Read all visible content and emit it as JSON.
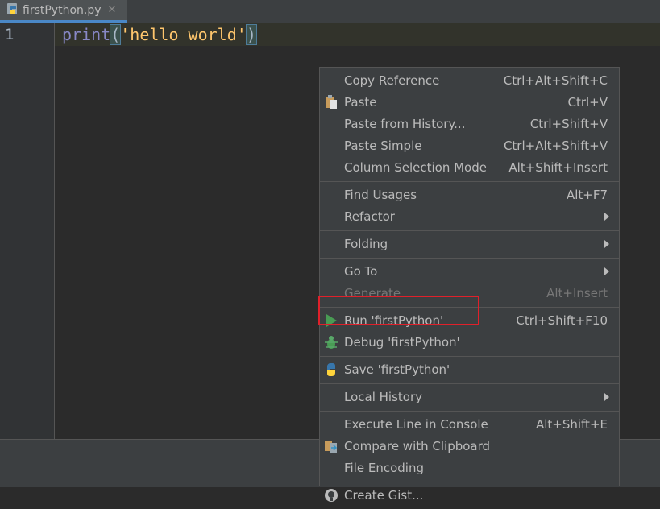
{
  "tab": {
    "filename": "firstPython.py",
    "close_glyph": "✕"
  },
  "editor": {
    "line_number": "1",
    "code": {
      "fn": "print",
      "open": "(",
      "string": "'hello world'",
      "close": ")"
    }
  },
  "menu": {
    "groups": [
      [
        {
          "label": "Copy Reference",
          "shortcut": "Ctrl+Alt+Shift+C"
        },
        {
          "label": "Paste",
          "shortcut": "Ctrl+V",
          "icon": "clipboard-icon"
        },
        {
          "label": "Paste from History...",
          "shortcut": "Ctrl+Shift+V"
        },
        {
          "label": "Paste Simple",
          "shortcut": "Ctrl+Alt+Shift+V"
        },
        {
          "label": "Column Selection Mode",
          "shortcut": "Alt+Shift+Insert"
        }
      ],
      [
        {
          "label": "Find Usages",
          "shortcut": "Alt+F7"
        },
        {
          "label": "Refactor",
          "submenu": true
        }
      ],
      [
        {
          "label": "Folding",
          "submenu": true
        }
      ],
      [
        {
          "label": "Go To",
          "submenu": true
        },
        {
          "label": "Generate...",
          "shortcut": "Alt+Insert",
          "disabled": true
        }
      ],
      [
        {
          "label": "Run 'firstPython'",
          "shortcut": "Ctrl+Shift+F10",
          "icon": "run-icon"
        },
        {
          "label": "Debug 'firstPython'",
          "icon": "debug-icon"
        }
      ],
      [
        {
          "label": "Save 'firstPython'",
          "icon": "python-icon"
        }
      ],
      [
        {
          "label": "Local History",
          "submenu": true
        }
      ],
      [
        {
          "label": "Execute Line in Console",
          "shortcut": "Alt+Shift+E"
        },
        {
          "label": "Compare with Clipboard",
          "icon": "compare-icon"
        },
        {
          "label": "File Encoding"
        }
      ],
      [
        {
          "label": "Create Gist...",
          "icon": "github-icon"
        }
      ]
    ]
  },
  "colors": {
    "highlight_box": "#e0202a",
    "run_green": "#499c54"
  }
}
